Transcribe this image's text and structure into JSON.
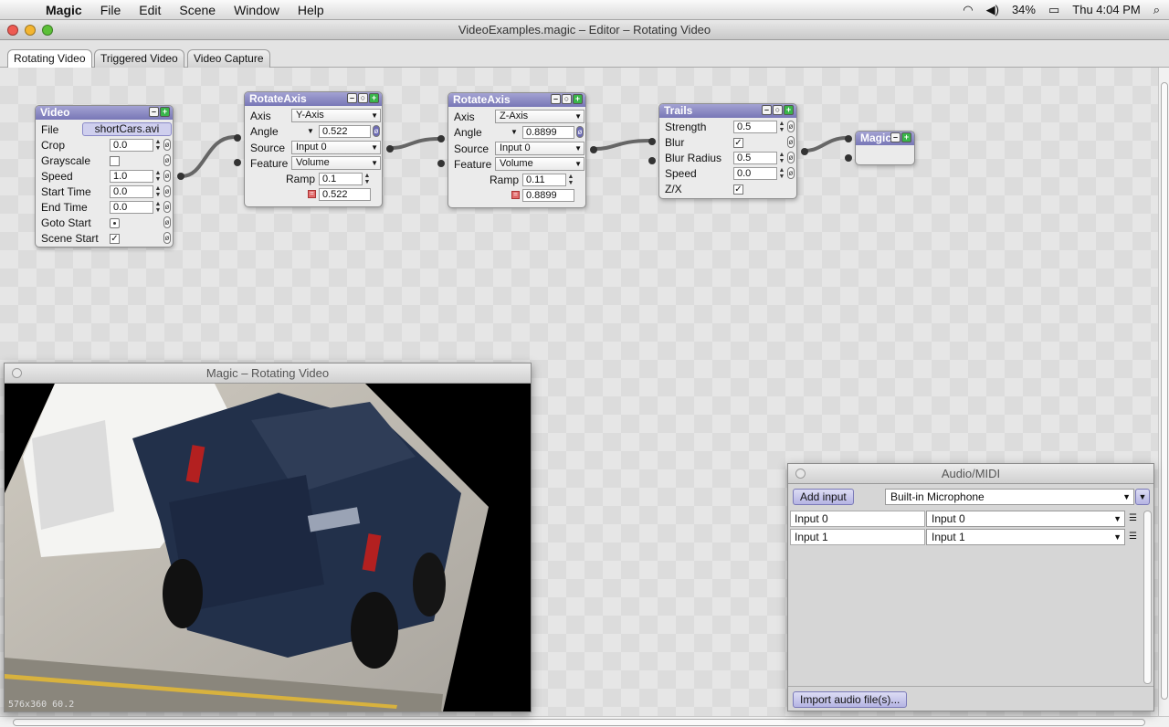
{
  "menubar": {
    "app": "Magic",
    "items": [
      "File",
      "Edit",
      "Scene",
      "Window",
      "Help"
    ],
    "battery": "34%",
    "clock": "Thu 4:04 PM"
  },
  "window": {
    "title": "VideoExamples.magic – Editor – Rotating Video"
  },
  "tabs": [
    "Rotating Video",
    "Triggered Video",
    "Video Capture"
  ],
  "modules": {
    "video": {
      "title": "Video",
      "file_label": "File",
      "file_value": "shortCars.avi",
      "crop_label": "Crop",
      "crop_value": "0.0",
      "grayscale_label": "Grayscale",
      "speed_label": "Speed",
      "speed_value": "1.0",
      "start_label": "Start Time",
      "start_value": "0.0",
      "end_label": "End Time",
      "end_value": "0.0",
      "goto_label": "Goto Start",
      "scene_label": "Scene Start"
    },
    "rotate1": {
      "title": "RotateAxis",
      "axis_label": "Axis",
      "axis_value": "Y-Axis",
      "angle_label": "Angle",
      "angle_value": "0.522",
      "source_label": "Source",
      "source_value": "Input 0",
      "feature_label": "Feature",
      "feature_value": "Volume",
      "ramp_label": "Ramp",
      "ramp_value": "0.1",
      "out_value": "0.522"
    },
    "rotate2": {
      "title": "RotateAxis",
      "axis_label": "Axis",
      "axis_value": "Z-Axis",
      "angle_label": "Angle",
      "angle_value": "0.8899",
      "source_label": "Source",
      "source_value": "Input 0",
      "feature_label": "Feature",
      "feature_value": "Volume",
      "ramp_label": "Ramp",
      "ramp_value": "0.11",
      "out_value": "0.8899"
    },
    "trails": {
      "title": "Trails",
      "strength_label": "Strength",
      "strength_value": "0.5",
      "blur_label": "Blur",
      "radius_label": "Blur Radius",
      "radius_value": "0.5",
      "speed_label": "Speed",
      "speed_value": "0.0",
      "zx_label": "Z/X"
    },
    "magic": {
      "title": "Magic"
    }
  },
  "preview": {
    "title": "Magic – Rotating Video",
    "info": "576x360  60.2"
  },
  "audio": {
    "title": "Audio/MIDI",
    "add_input": "Add input",
    "device": "Built-in Microphone",
    "inputs": [
      {
        "name": "Input 0",
        "source": "Input 0"
      },
      {
        "name": "Input 1",
        "source": "Input 1"
      }
    ],
    "import": "Import audio file(s)..."
  },
  "colors": {
    "module_header": "#7877b6",
    "port": "#333333",
    "wire": "#666666"
  }
}
